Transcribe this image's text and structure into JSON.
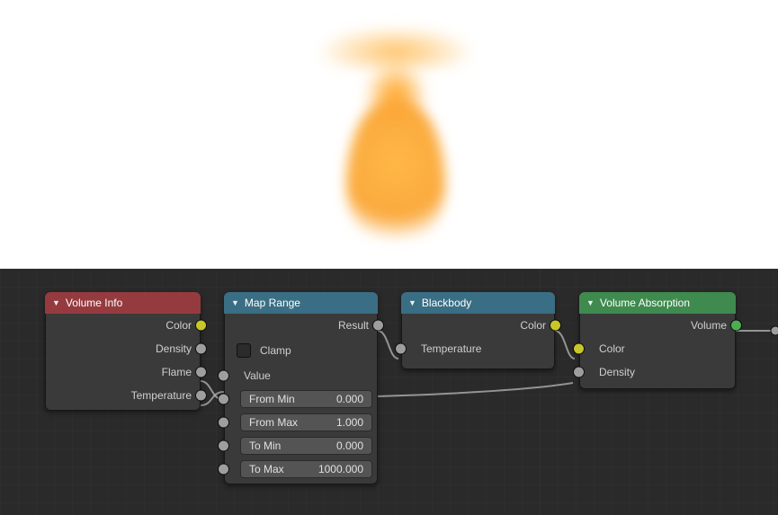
{
  "nodes": {
    "volume_info": {
      "title": "Volume Info",
      "outputs": {
        "color": "Color",
        "density": "Density",
        "flame": "Flame",
        "temperature": "Temperature"
      }
    },
    "map_range": {
      "title": "Map Range",
      "outputs": {
        "result": "Result"
      },
      "clamp_label": "Clamp",
      "inputs": {
        "value": "Value"
      },
      "fields": {
        "from_min": {
          "label": "From Min",
          "value": "0.000"
        },
        "from_max": {
          "label": "From Max",
          "value": "1.000"
        },
        "to_min": {
          "label": "To Min",
          "value": "0.000"
        },
        "to_max": {
          "label": "To Max",
          "value": "1000.000"
        }
      }
    },
    "blackbody": {
      "title": "Blackbody",
      "outputs": {
        "color": "Color"
      },
      "inputs": {
        "temperature": "Temperature"
      }
    },
    "volume_absorption": {
      "title": "Volume Absorption",
      "outputs": {
        "volume": "Volume"
      },
      "inputs": {
        "color": "Color",
        "density": "Density"
      }
    }
  }
}
